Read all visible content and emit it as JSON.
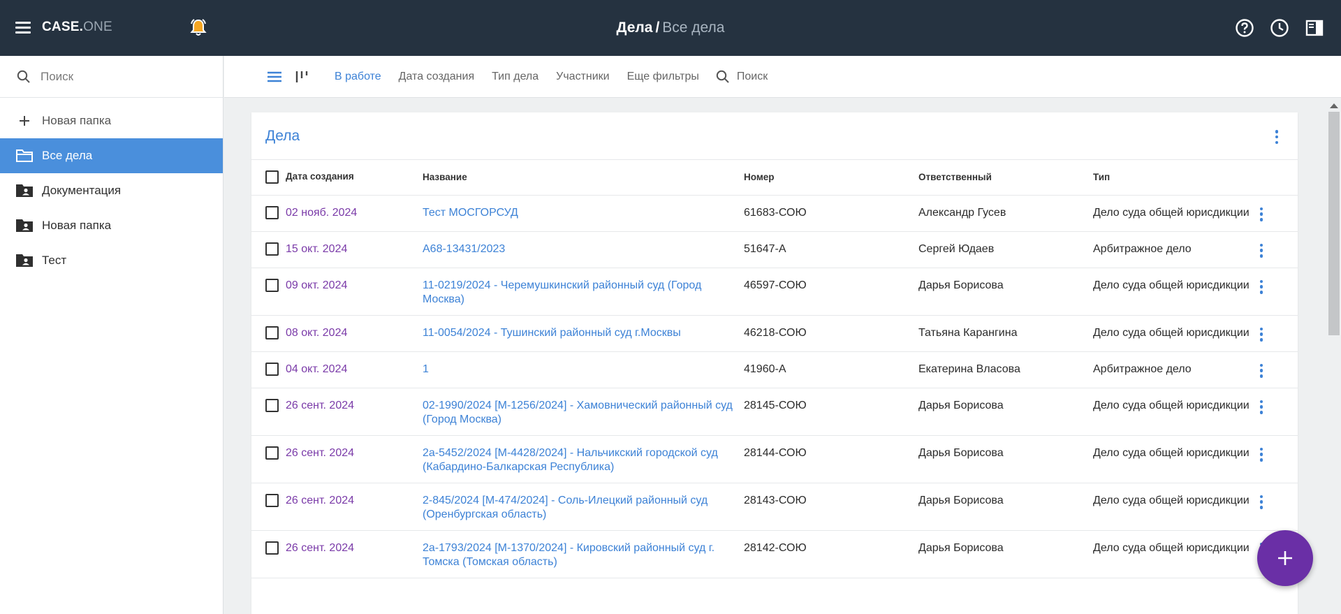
{
  "app": {
    "logo_part_a": "CASE.",
    "logo_part_b": "ONE",
    "breadcrumb": {
      "section": "Дела",
      "separator": "/",
      "current": "Все дела"
    }
  },
  "colors": {
    "topbar": "#253240",
    "accent": "#3d82d6",
    "active_folder": "#4a8fdc",
    "date_text": "#7a3aa8",
    "fab": "#6a2fa6",
    "bell": "#f5a623"
  },
  "icons": {
    "top_right": [
      "help-circle-icon",
      "clock-icon",
      "panel-layout-icon"
    ]
  },
  "sidebar": {
    "search_placeholder": "Поиск",
    "new_folder_label": "Новая папка",
    "items": [
      {
        "label": "Все дела",
        "icon": "folder-outline-icon",
        "active": true
      },
      {
        "label": "Документация",
        "icon": "shared-folder-icon",
        "active": false
      },
      {
        "label": "Новая папка",
        "icon": "shared-folder-icon",
        "active": false
      },
      {
        "label": "Тест",
        "icon": "shared-folder-icon",
        "active": false
      }
    ]
  },
  "filters": {
    "items": [
      "В работе",
      "Дата создания",
      "Тип дела",
      "Участники",
      "Еще фильтры"
    ],
    "search_placeholder": "Поиск"
  },
  "card": {
    "title": "Дела",
    "columns": [
      "Дата создания",
      "Название",
      "Номер",
      "Ответственный",
      "Тип"
    ],
    "rows": [
      {
        "date": "02 нояб. 2024",
        "name": "Тест МОСГОРСУД",
        "number": "61683-СОЮ",
        "responsible": "Александр Гусев",
        "type": "Дело суда общей юрисдик­ции"
      },
      {
        "date": "15 окт. 2024",
        "name": "А68-13431/2023",
        "number": "51647-А",
        "responsible": "Сергей Юдаев",
        "type": "Арбитражное дело"
      },
      {
        "date": "09 окт. 2024",
        "name": "11-0219/2024 - Черемушкинский районный суд (Город Москва)",
        "number": "46597-СОЮ",
        "responsible": "Дарья Борисова",
        "type": "Дело суда общей юрисдик­ции"
      },
      {
        "date": "08 окт. 2024",
        "name": "11-0054/2024 - Тушинский районный суд г.Москвы",
        "number": "46218-СОЮ",
        "responsible": "Татьяна Карангина",
        "type": "Дело суда общей юрисдик­ции"
      },
      {
        "date": "04 окт. 2024",
        "name": "1",
        "number": "41960-А",
        "responsible": "Екатерина Власова",
        "type": "Арбитражное дело"
      },
      {
        "date": "26 сент. 2024",
        "name": "02-1990/2024 [М-1256/2024] - Хамовнический районн­ый суд (Город Москва)",
        "number": "28145-СОЮ",
        "responsible": "Дарья Борисова",
        "type": "Дело суда общей юрисдик­ции"
      },
      {
        "date": "26 сент. 2024",
        "name": "2а-5452/2024 [М-4428/2024] - Нальчикский городской суд (Кабардино-Балкарская Республика)",
        "number": "28144-СОЮ",
        "responsible": "Дарья Борисова",
        "type": "Дело суда общей юрисдик­ции"
      },
      {
        "date": "26 сент. 2024",
        "name": "2-845/2024 [М-474/2024] - Соль-Илецкий районный суд (Оренбургская область)",
        "number": "28143-СОЮ",
        "responsible": "Дарья Борисова",
        "type": "Дело суда общей юрисдик­ции"
      },
      {
        "date": "26 сент. 2024",
        "name": "2а-1793/2024 [М-1370/2024] - Кировский районный су­д г. Томска (Томская область)",
        "number": "28142-СОЮ",
        "responsible": "Дарья Борисова",
        "type": "Дело суда общей юрисдик­ции"
      }
    ]
  }
}
